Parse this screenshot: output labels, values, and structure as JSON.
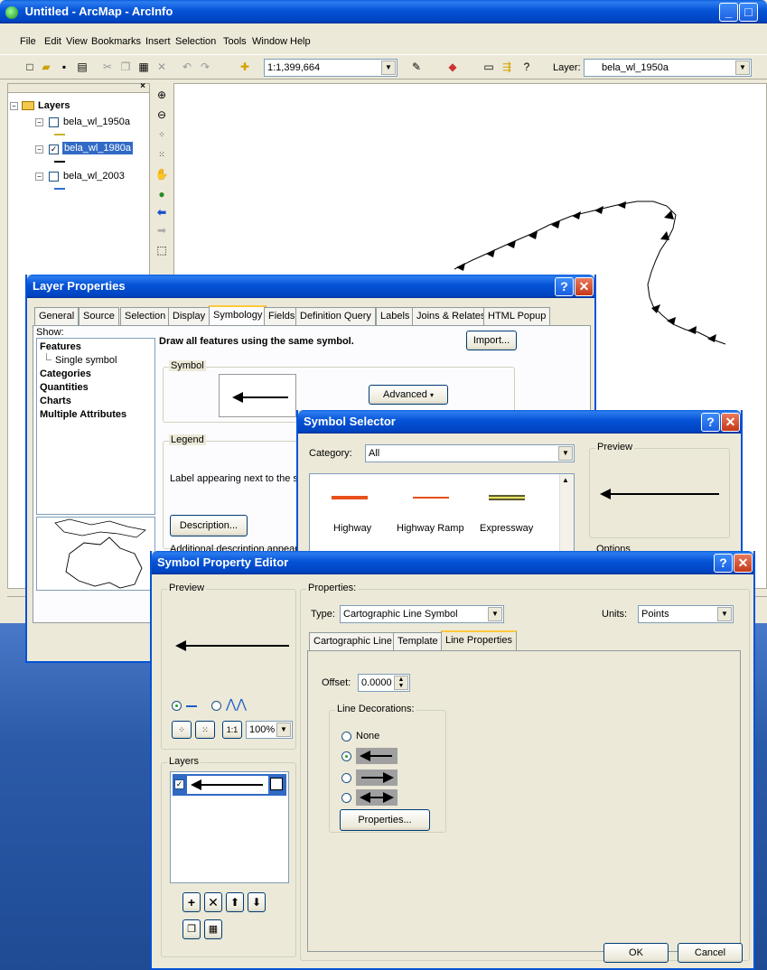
{
  "app": {
    "title": "Untitled - ArcMap - ArcInfo",
    "menu": [
      "File",
      "Edit",
      "View",
      "Bookmarks",
      "Insert",
      "Selection",
      "Tools",
      "Window",
      "Help"
    ],
    "scale": "1:1,399,664",
    "layer_label": "Layer:",
    "layer_value": "bela_wl_1950a"
  },
  "toc": {
    "root": "Layers",
    "layers": [
      {
        "name": "bela_wl_1950a",
        "checked": false
      },
      {
        "name": "bela_wl_1980a",
        "checked": true
      },
      {
        "name": "bela_wl_2003",
        "checked": false
      }
    ]
  },
  "layer_properties": {
    "title": "Layer Properties",
    "tabs": [
      "General",
      "Source",
      "Selection",
      "Display",
      "Symbology",
      "Fields",
      "Definition Query",
      "Labels",
      "Joins & Relates",
      "HTML Popup"
    ],
    "active_tab": "Symbology",
    "show_label": "Show:",
    "show_items": [
      "Features",
      "Single symbol",
      "Categories",
      "Quantities",
      "Charts",
      "Multiple Attributes"
    ],
    "heading": "Draw all features using the same symbol.",
    "import_button": "Import...",
    "symbol_group": "Symbol",
    "advanced_button": "Advanced",
    "legend_group": "Legend",
    "legend_text": "Label appearing next to the sym",
    "description_button": "Description...",
    "additional_text": "Additional description appearing"
  },
  "symbol_selector": {
    "title": "Symbol Selector",
    "category_label": "Category:",
    "category_value": "All",
    "preview_label": "Preview",
    "options_label": "Options",
    "symbols": [
      {
        "name": "Highway",
        "color": "#e8501c"
      },
      {
        "name": "Highway Ramp",
        "color": "#e8501c"
      },
      {
        "name": "Expressway",
        "color": "#5b5b32"
      }
    ]
  },
  "spe": {
    "title": "Symbol Property Editor",
    "preview_label": "Preview",
    "zoom": "100%",
    "layers_label": "Layers",
    "properties_label": "Properties:",
    "type_label": "Type:",
    "type_value": "Cartographic Line Symbol",
    "units_label": "Units:",
    "units_value": "Points",
    "tabs": [
      "Cartographic Line",
      "Template",
      "Line Properties"
    ],
    "offset_label": "Offset:",
    "offset_value": "0.0000",
    "decorations_label": "Line Decorations:",
    "none_label": "None",
    "properties_button": "Properties...",
    "ok": "OK",
    "cancel": "Cancel"
  },
  "colors": {
    "xp_blue": "#0553d6",
    "face": "#ece9d8",
    "desktop": "#2b5aa8",
    "selected": "#316ac5"
  }
}
